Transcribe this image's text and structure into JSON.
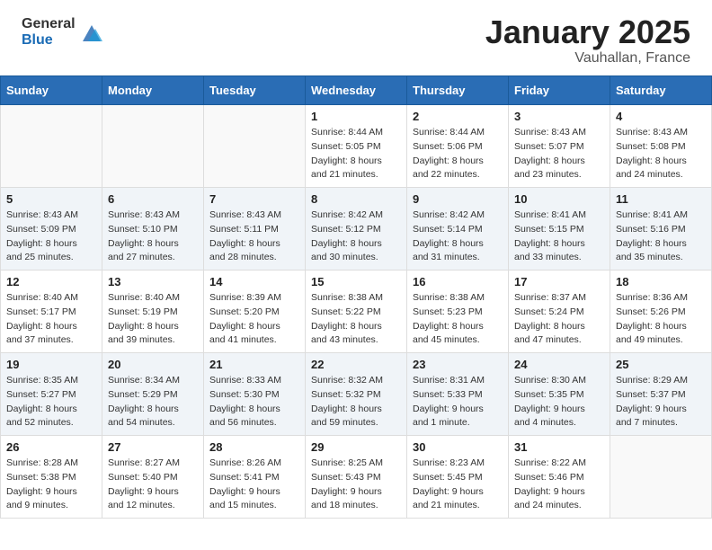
{
  "header": {
    "logo_general": "General",
    "logo_blue": "Blue",
    "month": "January 2025",
    "location": "Vauhallan, France"
  },
  "weekdays": [
    "Sunday",
    "Monday",
    "Tuesday",
    "Wednesday",
    "Thursday",
    "Friday",
    "Saturday"
  ],
  "weeks": [
    [
      {
        "day": "",
        "info": ""
      },
      {
        "day": "",
        "info": ""
      },
      {
        "day": "",
        "info": ""
      },
      {
        "day": "1",
        "info": "Sunrise: 8:44 AM\nSunset: 5:05 PM\nDaylight: 8 hours\nand 21 minutes."
      },
      {
        "day": "2",
        "info": "Sunrise: 8:44 AM\nSunset: 5:06 PM\nDaylight: 8 hours\nand 22 minutes."
      },
      {
        "day": "3",
        "info": "Sunrise: 8:43 AM\nSunset: 5:07 PM\nDaylight: 8 hours\nand 23 minutes."
      },
      {
        "day": "4",
        "info": "Sunrise: 8:43 AM\nSunset: 5:08 PM\nDaylight: 8 hours\nand 24 minutes."
      }
    ],
    [
      {
        "day": "5",
        "info": "Sunrise: 8:43 AM\nSunset: 5:09 PM\nDaylight: 8 hours\nand 25 minutes."
      },
      {
        "day": "6",
        "info": "Sunrise: 8:43 AM\nSunset: 5:10 PM\nDaylight: 8 hours\nand 27 minutes."
      },
      {
        "day": "7",
        "info": "Sunrise: 8:43 AM\nSunset: 5:11 PM\nDaylight: 8 hours\nand 28 minutes."
      },
      {
        "day": "8",
        "info": "Sunrise: 8:42 AM\nSunset: 5:12 PM\nDaylight: 8 hours\nand 30 minutes."
      },
      {
        "day": "9",
        "info": "Sunrise: 8:42 AM\nSunset: 5:14 PM\nDaylight: 8 hours\nand 31 minutes."
      },
      {
        "day": "10",
        "info": "Sunrise: 8:41 AM\nSunset: 5:15 PM\nDaylight: 8 hours\nand 33 minutes."
      },
      {
        "day": "11",
        "info": "Sunrise: 8:41 AM\nSunset: 5:16 PM\nDaylight: 8 hours\nand 35 minutes."
      }
    ],
    [
      {
        "day": "12",
        "info": "Sunrise: 8:40 AM\nSunset: 5:17 PM\nDaylight: 8 hours\nand 37 minutes."
      },
      {
        "day": "13",
        "info": "Sunrise: 8:40 AM\nSunset: 5:19 PM\nDaylight: 8 hours\nand 39 minutes."
      },
      {
        "day": "14",
        "info": "Sunrise: 8:39 AM\nSunset: 5:20 PM\nDaylight: 8 hours\nand 41 minutes."
      },
      {
        "day": "15",
        "info": "Sunrise: 8:38 AM\nSunset: 5:22 PM\nDaylight: 8 hours\nand 43 minutes."
      },
      {
        "day": "16",
        "info": "Sunrise: 8:38 AM\nSunset: 5:23 PM\nDaylight: 8 hours\nand 45 minutes."
      },
      {
        "day": "17",
        "info": "Sunrise: 8:37 AM\nSunset: 5:24 PM\nDaylight: 8 hours\nand 47 minutes."
      },
      {
        "day": "18",
        "info": "Sunrise: 8:36 AM\nSunset: 5:26 PM\nDaylight: 8 hours\nand 49 minutes."
      }
    ],
    [
      {
        "day": "19",
        "info": "Sunrise: 8:35 AM\nSunset: 5:27 PM\nDaylight: 8 hours\nand 52 minutes."
      },
      {
        "day": "20",
        "info": "Sunrise: 8:34 AM\nSunset: 5:29 PM\nDaylight: 8 hours\nand 54 minutes."
      },
      {
        "day": "21",
        "info": "Sunrise: 8:33 AM\nSunset: 5:30 PM\nDaylight: 8 hours\nand 56 minutes."
      },
      {
        "day": "22",
        "info": "Sunrise: 8:32 AM\nSunset: 5:32 PM\nDaylight: 8 hours\nand 59 minutes."
      },
      {
        "day": "23",
        "info": "Sunrise: 8:31 AM\nSunset: 5:33 PM\nDaylight: 9 hours\nand 1 minute."
      },
      {
        "day": "24",
        "info": "Sunrise: 8:30 AM\nSunset: 5:35 PM\nDaylight: 9 hours\nand 4 minutes."
      },
      {
        "day": "25",
        "info": "Sunrise: 8:29 AM\nSunset: 5:37 PM\nDaylight: 9 hours\nand 7 minutes."
      }
    ],
    [
      {
        "day": "26",
        "info": "Sunrise: 8:28 AM\nSunset: 5:38 PM\nDaylight: 9 hours\nand 9 minutes."
      },
      {
        "day": "27",
        "info": "Sunrise: 8:27 AM\nSunset: 5:40 PM\nDaylight: 9 hours\nand 12 minutes."
      },
      {
        "day": "28",
        "info": "Sunrise: 8:26 AM\nSunset: 5:41 PM\nDaylight: 9 hours\nand 15 minutes."
      },
      {
        "day": "29",
        "info": "Sunrise: 8:25 AM\nSunset: 5:43 PM\nDaylight: 9 hours\nand 18 minutes."
      },
      {
        "day": "30",
        "info": "Sunrise: 8:23 AM\nSunset: 5:45 PM\nDaylight: 9 hours\nand 21 minutes."
      },
      {
        "day": "31",
        "info": "Sunrise: 8:22 AM\nSunset: 5:46 PM\nDaylight: 9 hours\nand 24 minutes."
      },
      {
        "day": "",
        "info": ""
      }
    ]
  ]
}
